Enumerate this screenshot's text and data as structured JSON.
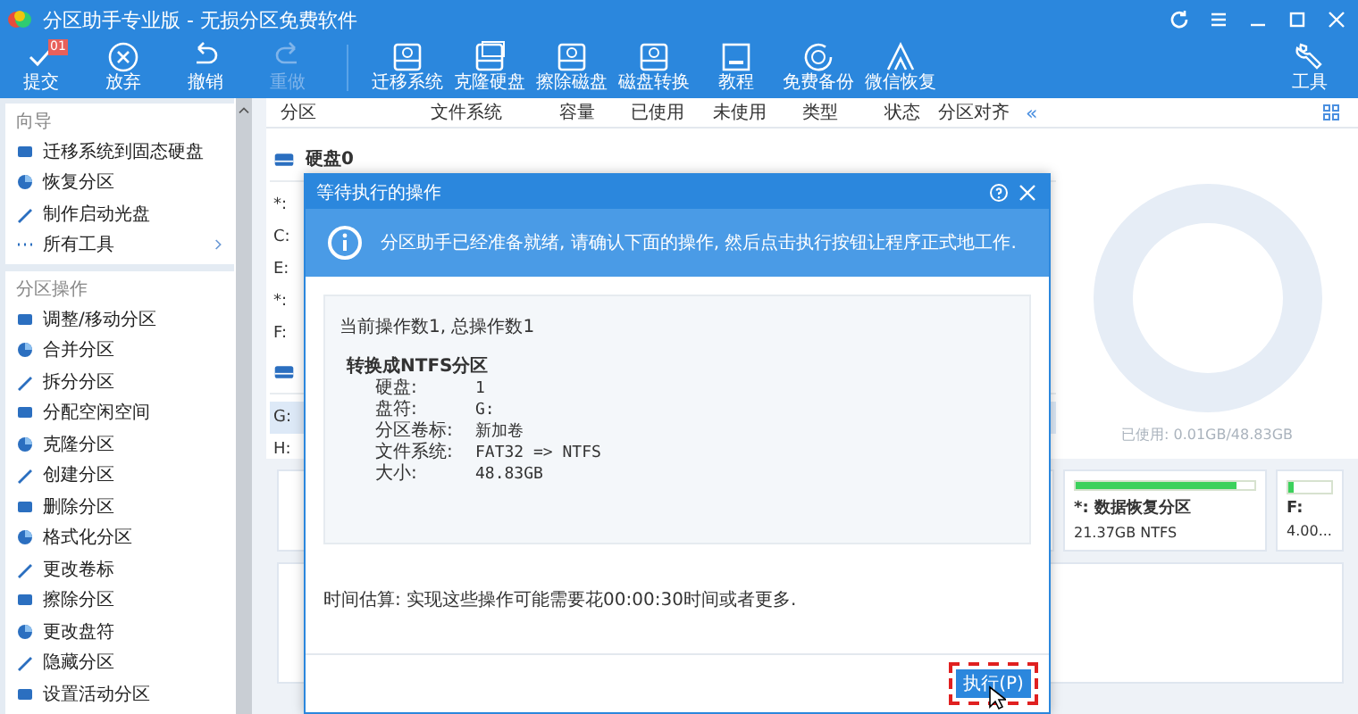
{
  "window": {
    "title": "分区助手专业版 - 无损分区免费软件"
  },
  "toolbar": {
    "groups": [
      [
        {
          "label": "提交",
          "badge": "01",
          "disabled": false
        },
        {
          "label": "放弃",
          "disabled": false
        },
        {
          "label": "撤销",
          "disabled": false
        },
        {
          "label": "重做",
          "disabled": true
        }
      ],
      [
        {
          "label": "迁移系统",
          "disabled": false
        },
        {
          "label": "克隆硬盘",
          "disabled": false
        },
        {
          "label": "擦除磁盘",
          "disabled": false
        },
        {
          "label": "磁盘转换",
          "disabled": false
        },
        {
          "label": "教程",
          "disabled": false
        },
        {
          "label": "免费备份",
          "disabled": false
        },
        {
          "label": "微信恢复",
          "disabled": false
        }
      ]
    ],
    "tools": {
      "label": "工具"
    }
  },
  "sidebar": {
    "sections": [
      {
        "title": "向导",
        "items": [
          {
            "label": "迁移系统到固态硬盘",
            "kind": "action"
          },
          {
            "label": "恢复分区",
            "kind": "action"
          },
          {
            "label": "制作启动光盘",
            "kind": "action"
          },
          {
            "label": "所有工具",
            "kind": "more"
          }
        ]
      },
      {
        "title": "分区操作",
        "items": [
          {
            "label": "调整/移动分区",
            "kind": "action"
          },
          {
            "label": "合并分区",
            "kind": "action"
          },
          {
            "label": "拆分分区",
            "kind": "action"
          },
          {
            "label": "分配空闲空间",
            "kind": "action"
          },
          {
            "label": "克隆分区",
            "kind": "action"
          },
          {
            "label": "创建分区",
            "kind": "action"
          },
          {
            "label": "删除分区",
            "kind": "action"
          },
          {
            "label": "格式化分区",
            "kind": "action"
          },
          {
            "label": "更改卷标",
            "kind": "action"
          },
          {
            "label": "擦除分区",
            "kind": "action"
          },
          {
            "label": "更改盘符",
            "kind": "action"
          },
          {
            "label": "隐藏分区",
            "kind": "action"
          },
          {
            "label": "设置活动分区",
            "kind": "action"
          }
        ]
      }
    ]
  },
  "table": {
    "columns": [
      "分区",
      "文件系统",
      "容量",
      "已使用",
      "未使用",
      "类型",
      "状态",
      "分区对齐"
    ],
    "collapse": "«",
    "rows": [
      {
        "kind": "disk",
        "label": "硬盘0",
        "selected": false
      },
      {
        "kind": "partition",
        "label": "*:",
        "selected": false
      },
      {
        "kind": "partition",
        "label": "C:",
        "selected": false
      },
      {
        "kind": "partition",
        "label": "E:",
        "selected": false
      },
      {
        "kind": "partition",
        "label": "*:",
        "selected": false
      },
      {
        "kind": "partition",
        "label": "F:",
        "selected": false
      },
      {
        "kind": "disk",
        "selected": false
      },
      {
        "kind": "partition",
        "label": "G:",
        "selected": true
      },
      {
        "kind": "partition",
        "label": "H:",
        "selected": false
      }
    ]
  },
  "usage": {
    "text": "已使用: 0.01GB/48.83GB"
  },
  "cards": [
    [
      {
        "kind": "hidden"
      },
      {
        "kind": "partition",
        "name": "*: 数据恢复分区",
        "detail": "21.37GB NTFS",
        "level": 0.9
      },
      {
        "kind": "partition",
        "name": "F:",
        "detail": "4.00...",
        "level": 0.12
      }
    ],
    [
      {
        "kind": "hidden"
      }
    ]
  ],
  "dialog": {
    "title": "等待执行的操作",
    "message": "分区助手已经准备就绪, 请确认下面的操作, 然后点击执行按钮让程序正式地工作.",
    "summary": "当前操作数1, 总操作数1",
    "operation": "转换成NTFS分区",
    "details": [
      {
        "label": "硬盘:",
        "value": "1"
      },
      {
        "label": "盘符:",
        "value": "G:"
      },
      {
        "label": "分区卷标:",
        "value": "新加卷"
      },
      {
        "label": "文件系统:",
        "value": "FAT32 => NTFS"
      },
      {
        "label": "大小:",
        "value": "48.83GB"
      }
    ],
    "estimate": "时间估算: 实现这些操作可能需要花00:00:30时间或者更多.",
    "button": "执行(P)"
  }
}
